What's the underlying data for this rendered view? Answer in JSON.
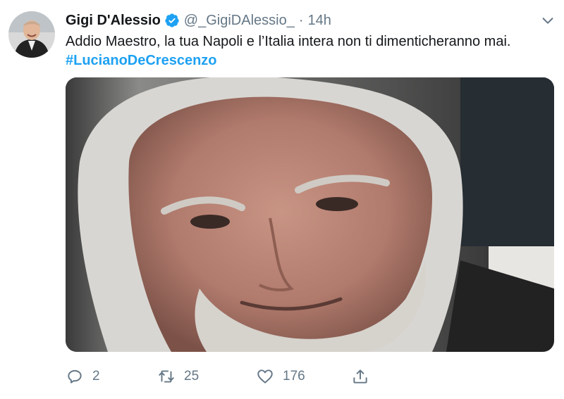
{
  "author": {
    "display_name": "Gigi D'Alessio",
    "handle": "@_GigiDAlessio_",
    "separator": "·",
    "time": "14h",
    "verified": true
  },
  "tweet": {
    "text": "Addio Maestro, la tua Napoli e l’Italia intera non ti dimenticheranno mai.",
    "hashtag": "#LucianoDeCrescenzo"
  },
  "actions": {
    "replies": "2",
    "retweets": "25",
    "likes": "176"
  },
  "colors": {
    "accent": "#1da1f2",
    "secondary_text": "#657786",
    "primary_text": "#14171a"
  },
  "icons": [
    "verified-badge-icon",
    "chevron-down-icon",
    "reply-icon",
    "retweet-icon",
    "like-icon",
    "share-icon"
  ]
}
